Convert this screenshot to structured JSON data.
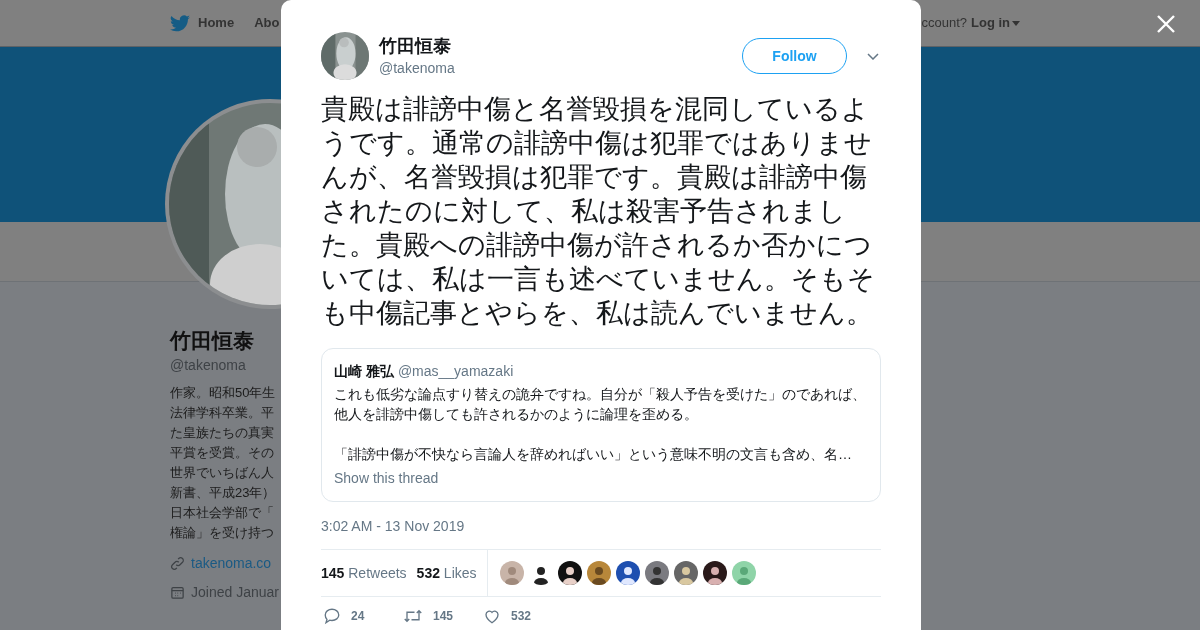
{
  "nav": {
    "items": [
      "Home",
      "Abo"
    ],
    "account_prompt": "ccount?",
    "login": "Log in"
  },
  "profile": {
    "name": "竹田恒泰",
    "handle": "@takenoma",
    "bio_lines": [
      "作家。昭和50年生",
      "法律学科卒業。平",
      "た皇族たちの真実",
      "平賞を受賞。その",
      "世界でいちばん人",
      "新書、平成23年）",
      "日本社会学部で「",
      "権論」を受け持つ"
    ],
    "link": "takenoma.co",
    "joined": "Joined Januar"
  },
  "modal": {
    "author": {
      "name": "竹田恒泰",
      "handle": "@takenoma"
    },
    "follow_label": "Follow",
    "text": "貴殿は誹謗中傷と名誉毀損を混同しているようです。通常の誹謗中傷は犯罪ではありませんが、名誉毀損は犯罪です。貴殿は誹謗中傷されたのに対して、私は殺害予告されました。貴殿への誹謗中傷が許されるか否かについては、私は一言も述べていません。そもそも中傷記事とやらを、私は読んでいません。",
    "quoted": {
      "name": "山崎 雅弘",
      "handle": "@mas__yamazaki",
      "paragraphs": [
        "これも低劣な論点すり替えの詭弁ですね。自分が「殺人予告を受けた」のであれば、他人を誹謗中傷しても許されるかのように論理を歪める。",
        "「誹謗中傷が不快なら言論人を辞めればいい」という意味不明の文言も含め、名…"
      ],
      "thread_link": "Show this thread"
    },
    "timestamp": "3:02 AM - 13 Nov 2019",
    "stats": [
      {
        "count": "145",
        "label": "Retweets"
      },
      {
        "count": "532",
        "label": "Likes"
      }
    ],
    "actions": [
      {
        "kind": "reply",
        "count": "24"
      },
      {
        "kind": "retweet",
        "count": "145"
      },
      {
        "kind": "like",
        "count": "532"
      }
    ]
  }
}
